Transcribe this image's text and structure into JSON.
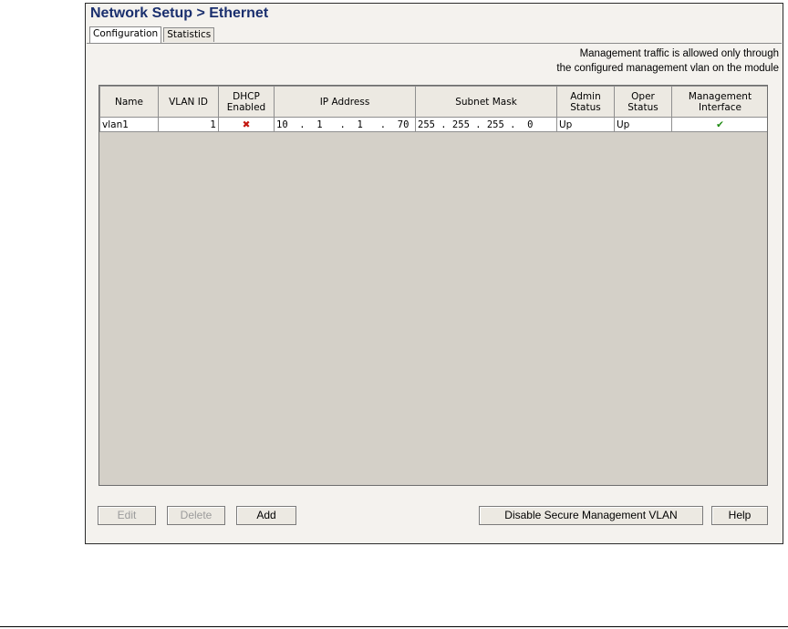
{
  "window": {
    "title": "Network Setup > Ethernet"
  },
  "tabs": [
    {
      "label": "Configuration",
      "active": true
    },
    {
      "label": "Statistics",
      "active": false
    }
  ],
  "note": {
    "line1": "Management traffic is allowed only through",
    "line2": "the configured management vlan on the module"
  },
  "table": {
    "headers": {
      "name": "Name",
      "vlan_id": "VLAN ID",
      "dhcp": "DHCP Enabled",
      "ip": "IP Address",
      "mask": "Subnet Mask",
      "admin": "Admin Status",
      "oper": "Oper Status",
      "mgmt": "Management Interface"
    },
    "rows": [
      {
        "name": "vlan1",
        "vlan_id": "1",
        "dhcp_icon": "x-mark-icon",
        "dhcp_enabled": false,
        "ip": "10  .  1   .  1   .  70",
        "mask": "255 . 255 . 255 .  0",
        "admin": "Up",
        "oper": "Up",
        "mgmt_icon": "check-mark-icon",
        "management_interface": true
      }
    ]
  },
  "buttons": {
    "edit": "Edit",
    "delete": "Delete",
    "add": "Add",
    "disable_secure": "Disable Secure Management VLAN",
    "help": "Help"
  },
  "colors": {
    "title": "#1a2f6e",
    "x_mark": "#c4170f",
    "check_mark": "#1f8b12",
    "grid_background": "#d4d0c8"
  }
}
